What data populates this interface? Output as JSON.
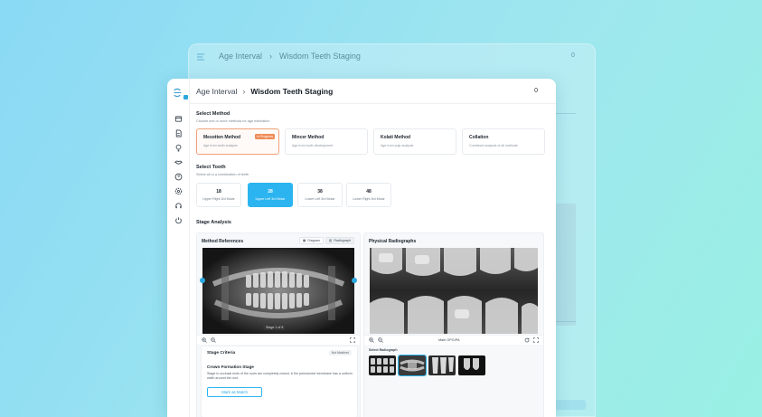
{
  "app": {
    "breadcrumb": [
      "Age Interval",
      "Wisdom Teeth Staging"
    ],
    "breadcrumb_sep": "›",
    "notification_count": "0"
  },
  "select_method": {
    "title": "Select Method",
    "subtitle": "Choose one or more methods for age estimation",
    "methods": [
      {
        "name": "Mesotten Method",
        "desc": "Age from tooth analysis",
        "badge": "In Progress",
        "selected": true
      },
      {
        "name": "Mincer Method",
        "desc": "Age from tooth development",
        "badge": "",
        "selected": false
      },
      {
        "name": "Kolati Method",
        "desc": "Age from pulp analysis",
        "badge": "",
        "selected": false
      },
      {
        "name": "Collation",
        "desc": "Combined analysis of all methods",
        "badge": "",
        "selected": false
      }
    ]
  },
  "select_tooth": {
    "title": "Select Tooth",
    "subtitle": "Select all or a combination of teeth",
    "teeth": [
      {
        "number": "18",
        "label": "Upper Right 3rd Molar",
        "selected": false
      },
      {
        "number": "28",
        "label": "Upper Left 3rd Molar",
        "selected": true
      },
      {
        "number": "38",
        "label": "Lower Left 3rd Molar",
        "selected": false
      },
      {
        "number": "48",
        "label": "Lower Right 3rd Molar",
        "selected": false
      }
    ]
  },
  "stage_analysis": {
    "title": "Stage Analysis",
    "method_references": {
      "title": "Method References",
      "toggle": [
        "Diagram",
        "Radiograph"
      ],
      "toggle_active": "Radiograph",
      "stage_chip": "Stage 1 of 8"
    },
    "physical_radiographs": {
      "title": "Physical Radiographs",
      "image_label": "Main OPG/PA",
      "select_label": "Select Radiograph",
      "selected_thumb_index": 1
    },
    "stage_criteria": {
      "title": "Stage Criteria",
      "badge": "Not Matched",
      "stage_name": "Crown Formation Stage",
      "description": "Stage in occlusal ends of the roots are completely closed, & the periodontal membrane has a uniform width around the root.",
      "button": "Mark as Match"
    }
  },
  "colors": {
    "accent": "#2bb4f0",
    "badge_orange": "#ef8b57",
    "selected_border": "#f0a17a"
  },
  "icons": [
    "logo-icon",
    "cube-icon",
    "file-icon",
    "bulb-icon",
    "tooth-icon",
    "help-icon",
    "settings-icon",
    "headset-icon",
    "power-icon",
    "zoom-in-icon",
    "zoom-out-icon",
    "fullscreen-icon",
    "refresh-icon"
  ]
}
